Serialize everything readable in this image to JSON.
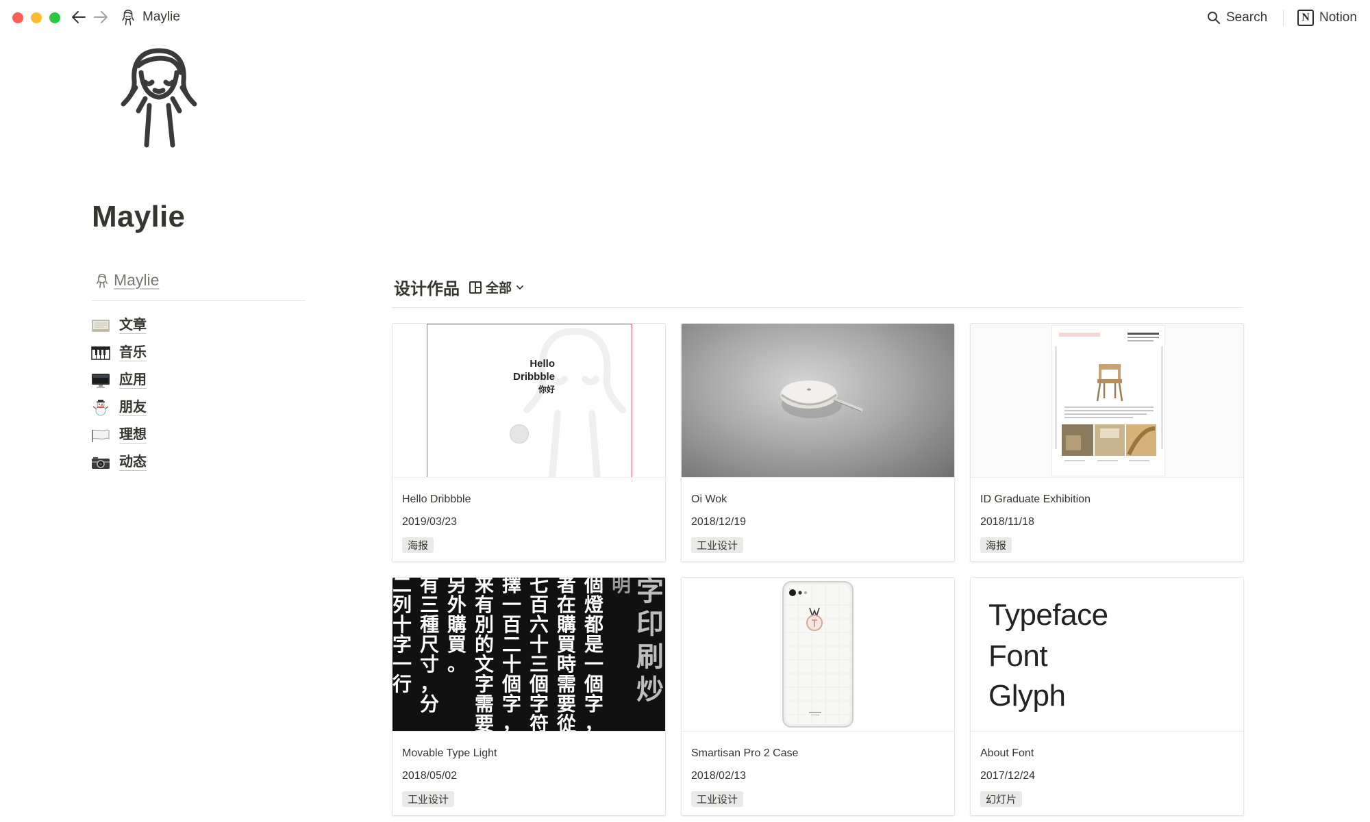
{
  "window": {
    "title": "Maylie",
    "colors": {
      "close": "#ff5f57",
      "minimize": "#febc2e",
      "maximize": "#28c840"
    }
  },
  "topbar": {
    "breadcrumb": "Maylie",
    "search_label": "Search",
    "notion_label": "Notion"
  },
  "page": {
    "title": "Maylie",
    "icon": "girl-sketch-icon"
  },
  "left": {
    "link_label": "Maylie",
    "items": [
      {
        "icon": "notebook-icon",
        "label": "文章"
      },
      {
        "icon": "piano-keys-icon",
        "label": "音乐"
      },
      {
        "icon": "desktop-computer-icon",
        "label": "应用"
      },
      {
        "icon": "snowman-icon",
        "label": "朋友"
      },
      {
        "icon": "white-flag-icon",
        "label": "理想"
      },
      {
        "icon": "camera-icon",
        "label": "动态"
      }
    ]
  },
  "gallery": {
    "title": "设计作品",
    "view_label": "全部",
    "cards": [
      {
        "name": "Hello Dribbble",
        "date": "2019/03/23",
        "tag": "海报"
      },
      {
        "name": "Oi Wok",
        "date": "2018/12/19",
        "tag": "工业设计"
      },
      {
        "name": "ID Graduate Exhibition",
        "date": "2018/11/18",
        "tag": "海报"
      },
      {
        "name": "Movable Type Light",
        "date": "2018/05/02",
        "tag": "工业设计"
      },
      {
        "name": "Smartisan Pro 2 Case",
        "date": "2018/02/13",
        "tag": "工业设计"
      },
      {
        "name": "About Font",
        "date": "2017/12/24",
        "tag": "幻灯片"
      }
    ],
    "cover_texts": {
      "hello_line1": "Hello",
      "hello_line2": "Dribbble",
      "hello_line3": "你好",
      "font_word1": "Typeface",
      "font_word2": "Font",
      "font_word3": "Glyph",
      "type_columns": [
        "二列十字一行",
        "有三種尺寸，分",
        "另外購買。",
        "来有別的文字需要",
        "擇一百二十個字，",
        "七百六十三個字符",
        "者在購買時需要從",
        "個燈都是一個字，",
        "明",
        "字印刷炒"
      ]
    }
  }
}
